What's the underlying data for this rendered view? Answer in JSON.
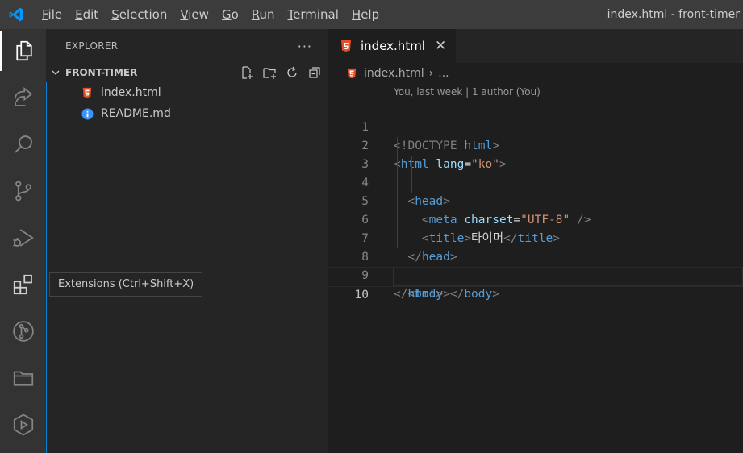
{
  "titlebar": {
    "logo_icon": "vscode-logo-icon",
    "menu": [
      {
        "mnemonic": "F",
        "rest": "ile"
      },
      {
        "mnemonic": "E",
        "rest": "dit"
      },
      {
        "mnemonic": "S",
        "rest": "election"
      },
      {
        "mnemonic": "V",
        "rest": "iew"
      },
      {
        "mnemonic": "G",
        "rest": "o"
      },
      {
        "mnemonic": "R",
        "rest": "un"
      },
      {
        "mnemonic": "T",
        "rest": "erminal"
      },
      {
        "mnemonic": "H",
        "rest": "elp"
      }
    ],
    "window_title": "index.html - front-timer"
  },
  "activity_bar": {
    "items": [
      "explorer-icon",
      "live-share-icon",
      "search-icon",
      "source-control-icon",
      "run-debug-icon",
      "extensions-icon",
      "git-graph-icon",
      "project-manager-icon",
      "live-preview-icon"
    ],
    "active": "explorer-icon"
  },
  "tooltip": {
    "text": "Extensions (Ctrl+Shift+X)"
  },
  "sidebar": {
    "title": "EXPLORER",
    "more": "···",
    "folder": {
      "name": "FRONT-TIMER",
      "actions": [
        "new-file-icon",
        "new-folder-icon",
        "refresh-icon",
        "collapse-all-icon"
      ]
    },
    "files": [
      {
        "name": "index.html",
        "icon": "html5-icon"
      },
      {
        "name": "README.md",
        "icon": "info-icon"
      }
    ]
  },
  "editor": {
    "tab": {
      "label": "index.html",
      "close": "✕"
    },
    "breadcrumb": {
      "file": "index.html",
      "separator": "›",
      "more": "..."
    },
    "codelens": "You, last week | 1 author (You)",
    "line_numbers": [
      "1",
      "2",
      "3",
      "4",
      "5",
      "6",
      "7",
      "8",
      "9",
      "10"
    ],
    "current_line": 10
  },
  "colors": {
    "titlebar_bg": "#3c3c3c",
    "activity_bg": "#333333",
    "sidebar_bg": "#252526",
    "editor_bg": "#1e1e1e",
    "focus_border": "#007fd4",
    "html_icon": "#e44d26",
    "info_icon": "#3794ff",
    "vscode_blue": "#0098ff"
  }
}
